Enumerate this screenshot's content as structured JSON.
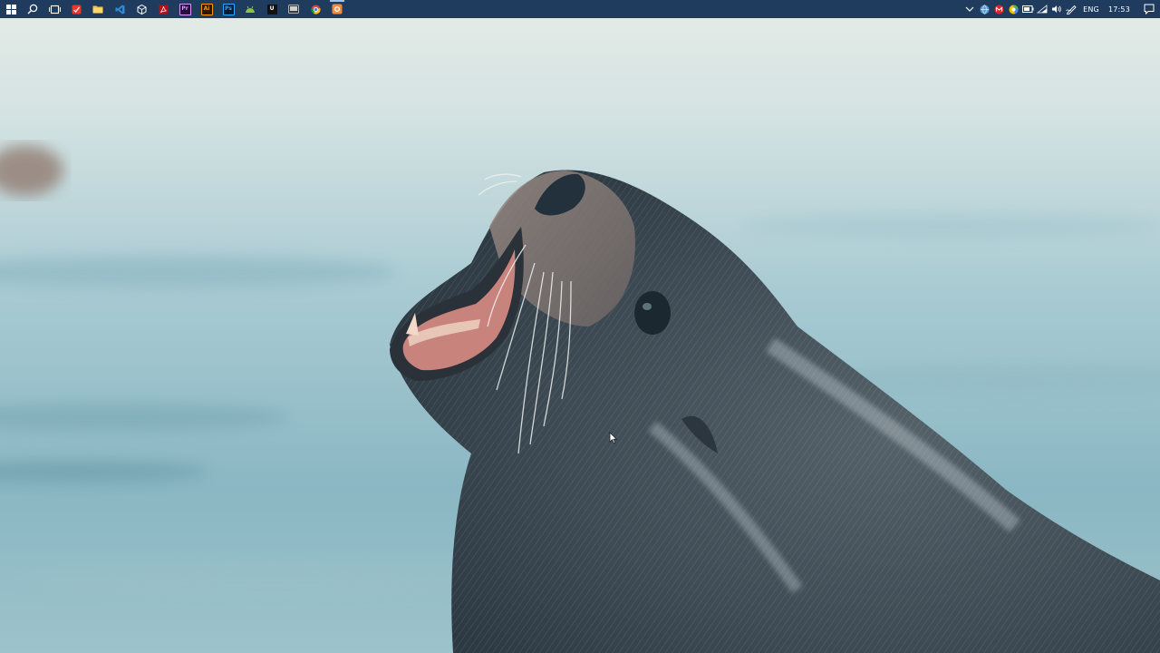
{
  "taskbar": {
    "background": "#1f3c5f",
    "start_icon": "windows-logo-icon",
    "search_icon": "search-icon",
    "task_view_icon": "task-view-icon",
    "pinned_apps": [
      {
        "name": "todoist-red-app",
        "glyph": "",
        "bg": "#e23b2e",
        "fg": "#ffffff"
      },
      {
        "name": "file-explorer-app",
        "glyph": "",
        "bg": "#f4c542",
        "fg": "#5a4200"
      },
      {
        "name": "visual-studio-code-app",
        "glyph": "",
        "bg": "#2e8ad8",
        "fg": "#ffffff"
      },
      {
        "name": "unity-app",
        "glyph": "",
        "bg": "transparent",
        "fg": "#ffffff"
      },
      {
        "name": "acrobat-app",
        "glyph": "",
        "bg": "#b3121c",
        "fg": "#ffffff"
      },
      {
        "name": "premiere-pro-app",
        "glyph": "Pr",
        "bg": "#2a0d3e",
        "fg": "#d59bff"
      },
      {
        "name": "illustrator-app",
        "glyph": "Ai",
        "bg": "#2c1600",
        "fg": "#ff9a00"
      },
      {
        "name": "photoshop-app",
        "glyph": "Ps",
        "bg": "#061c33",
        "fg": "#31a8ff"
      },
      {
        "name": "android-studio-app",
        "glyph": "",
        "bg": "transparent",
        "fg": "#8bc34a"
      },
      {
        "name": "unreal-engine-app",
        "glyph": "U",
        "bg": "#111111",
        "fg": "#ffffff"
      },
      {
        "name": "media-player-app",
        "glyph": "",
        "bg": "#3a3a3a",
        "fg": "#dddddd"
      },
      {
        "name": "chrome-app",
        "glyph": "",
        "bg": "transparent",
        "fg": "#ffffff"
      },
      {
        "name": "orange-app",
        "glyph": "",
        "bg": "#f08a3c",
        "fg": "#ffffff"
      }
    ],
    "tray": {
      "chevron_icon": "chevron-up-icon",
      "icons": [
        "network-globe-icon",
        "antivirus-icon",
        "google-drive-icon",
        "battery-icon",
        "wifi-icon",
        "volume-icon",
        "pen-ink-icon"
      ],
      "language": "ENG",
      "time": "17:53",
      "notification_icon": "action-center-icon"
    }
  },
  "wallpaper": {
    "subject": "sea-lion-icon",
    "sky_color": "#d9e5e3",
    "water_color": "#8fb9c5",
    "seal_color": "#3f4c55"
  }
}
